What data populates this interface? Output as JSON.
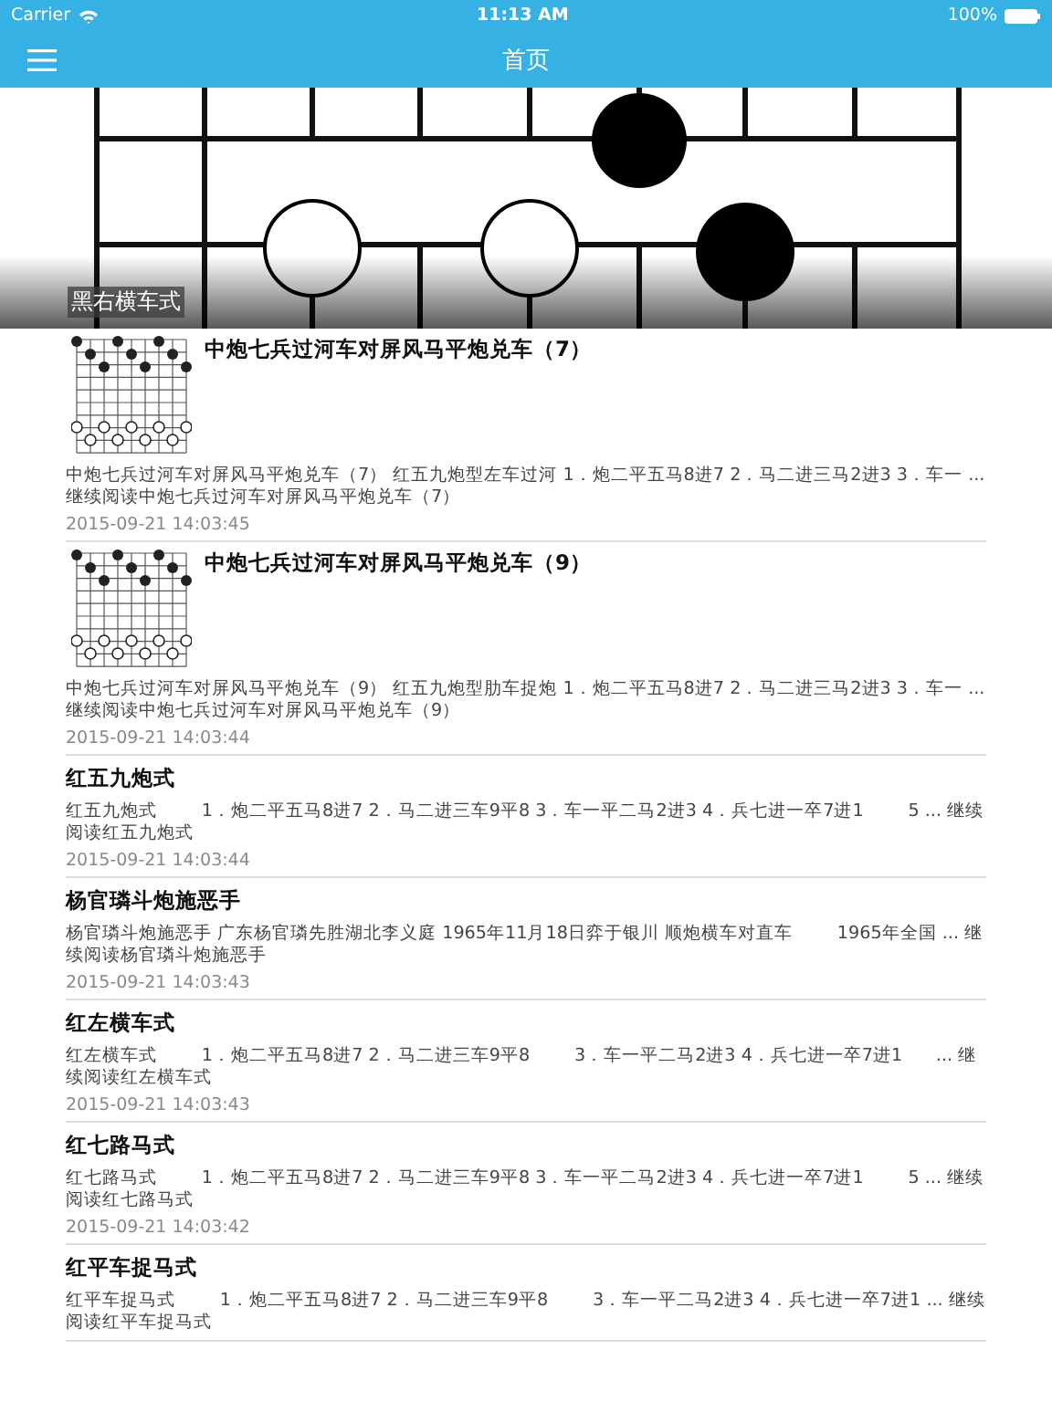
{
  "status_bar": {
    "carrier": "Carrier",
    "time": "11:13 AM",
    "battery": "100%"
  },
  "nav_bar": {
    "title": "首页"
  },
  "hero": {
    "caption": "黑右横车式"
  },
  "articles": [
    {
      "kind": "thumb",
      "title": "中炮七兵过河车对屏风马平炮兑车（7）",
      "excerpt": "中炮七兵过河车对屏风马平炮兑车（7） 红五九炮型左车过河 1．炮二平五马8进7 2．马二进三马2进3 3．车一 ... 继续阅读中炮七兵过河车对屏风马平炮兑车（7）",
      "date": "2015-09-21 14:03:45"
    },
    {
      "kind": "thumb",
      "title": "中炮七兵过河车对屏风马平炮兑车（9）",
      "excerpt": "中炮七兵过河车对屏风马平炮兑车（9） 红五九炮型肋车捉炮 1．炮二平五马8进7 2．马二进三马2进3 3．车一 ... 继续阅读中炮七兵过河车对屏风马平炮兑车（9）",
      "date": "2015-09-21 14:03:44"
    },
    {
      "kind": "text",
      "title": "红五九炮式",
      "excerpt": "红五九炮式        1．炮二平五马8进7 2．马二进三车9平8 3．车一平二马2进3 4．兵七进一卒7进1        5 ... 继续阅读红五九炮式",
      "date": "2015-09-21 14:03:44"
    },
    {
      "kind": "text",
      "title": "杨官璘斗炮施恶手",
      "excerpt": "杨官璘斗炮施恶手 广东杨官璘先胜湖北李义庭 1965年11月18日弈于银川 顺炮横车对直车        1965年全国 ... 继续阅读杨官璘斗炮施恶手",
      "date": "2015-09-21 14:03:43"
    },
    {
      "kind": "text",
      "title": "红左横车式",
      "excerpt": "红左横车式        1．炮二平五马8进7 2．马二进三车9平8        3．车一平二马2进3 4．兵七进一卒7进1      ... 继续阅读红左横车式",
      "date": "2015-09-21 14:03:43"
    },
    {
      "kind": "text",
      "title": "红七路马式",
      "excerpt": "红七路马式        1．炮二平五马8进7 2．马二进三车9平8 3．车一平二马2进3 4．兵七进一卒7进1        5 ... 继续阅读红七路马式",
      "date": "2015-09-21 14:03:42"
    },
    {
      "kind": "text",
      "title": "红平车捉马式",
      "excerpt": "红平车捉马式        1．炮二平五马8进7 2．马二进三车9平8        3．车一平二马2进3 4．兵七进一卒7进1 ... 继续阅读红平车捉马式"
    }
  ]
}
